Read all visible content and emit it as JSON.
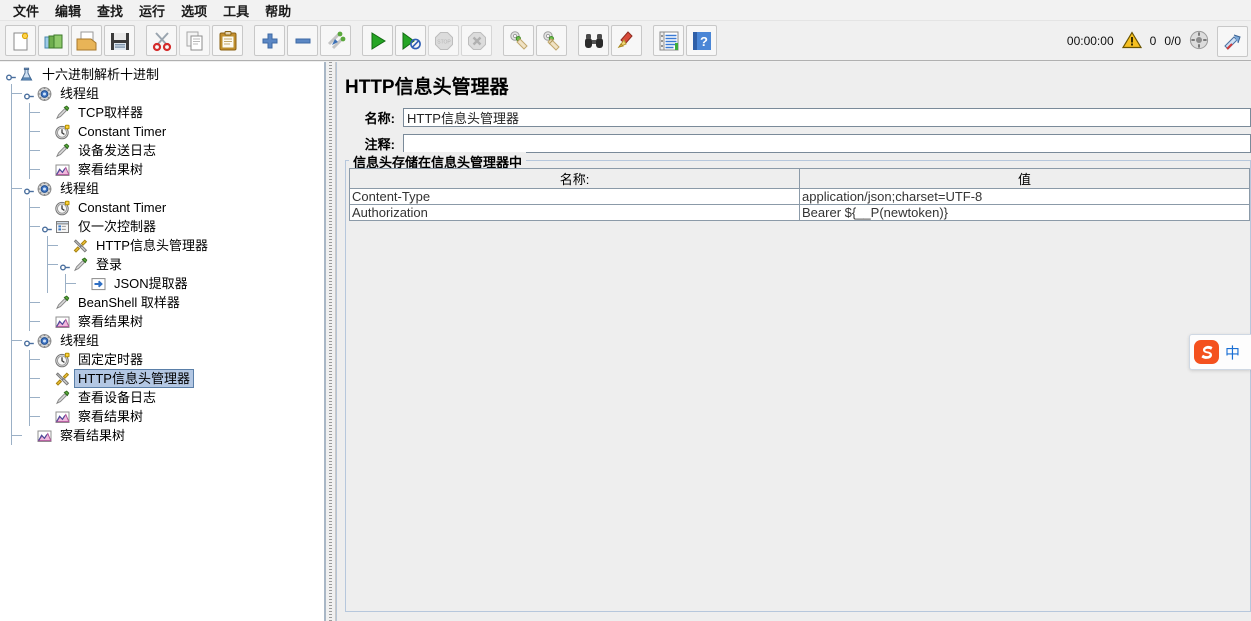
{
  "menubar": {
    "items": [
      {
        "label": "文件",
        "name": "menu-file"
      },
      {
        "label": "编辑",
        "name": "menu-edit"
      },
      {
        "label": "查找",
        "name": "menu-search"
      },
      {
        "label": "运行",
        "name": "menu-run"
      },
      {
        "label": "选项",
        "name": "menu-options"
      },
      {
        "label": "工具",
        "name": "menu-tools"
      },
      {
        "label": "帮助",
        "name": "menu-help"
      }
    ]
  },
  "toolbar": {
    "buttons": [
      {
        "icon": "new-document-icon",
        "title": "新建"
      },
      {
        "icon": "open-templates-icon",
        "title": "模板"
      },
      {
        "icon": "open-folder-icon",
        "title": "打开"
      },
      {
        "icon": "save-floppy-icon",
        "title": "保存"
      },
      {
        "icon": "cut-scissors-icon",
        "title": "剪切"
      },
      {
        "icon": "copy-pages-icon",
        "title": "复制"
      },
      {
        "icon": "paste-clipboard-icon",
        "title": "粘贴"
      },
      {
        "icon": "expand-plus-icon",
        "title": "展开全部"
      },
      {
        "icon": "collapse-minus-icon",
        "title": "折叠全部"
      },
      {
        "icon": "toggle-element-icon",
        "title": "启用/禁用"
      },
      {
        "icon": "start-play-icon",
        "title": "启动"
      },
      {
        "icon": "start-no-pauses-icon",
        "title": "无间隔启动"
      },
      {
        "icon": "stop-icon",
        "title": "停止"
      },
      {
        "icon": "shutdown-icon",
        "title": "关闭"
      },
      {
        "icon": "clear-broom-icon",
        "title": "清除"
      },
      {
        "icon": "clear-all-broom-icon",
        "title": "清除全部"
      },
      {
        "icon": "search-binoculars-icon",
        "title": "查找"
      },
      {
        "icon": "reset-search-broom-icon",
        "title": "重置查找"
      },
      {
        "icon": "function-helper-icon",
        "title": "函数助手对话框"
      },
      {
        "icon": "help-book-icon",
        "title": "帮助"
      }
    ],
    "status": {
      "elapsed": "00:00:00",
      "warning_icon": "warning-triangle-icon",
      "warning_count": "0",
      "threads": "0/0",
      "remote_icon": "remote-status-icon",
      "last_icon": "scissor-tool-icon"
    }
  },
  "tree": {
    "nodes": [
      {
        "label": "十六进制解析十进制",
        "icon": "test-plan-icon",
        "depth": 0,
        "handle": "expanded",
        "selected": false
      },
      {
        "label": "线程组",
        "icon": "thread-group-icon",
        "depth": 1,
        "handle": "expanded",
        "selected": false
      },
      {
        "label": "TCP取样器",
        "icon": "sampler-icon",
        "depth": 2,
        "handle": "leaf",
        "selected": false
      },
      {
        "label": "Constant Timer",
        "icon": "timer-icon",
        "depth": 2,
        "handle": "leaf",
        "selected": false
      },
      {
        "label": "设备发送日志",
        "icon": "sampler-icon",
        "depth": 2,
        "handle": "leaf",
        "selected": false
      },
      {
        "label": "察看结果树",
        "icon": "view-results-tree-icon",
        "depth": 2,
        "handle": "leaf-last",
        "selected": false
      },
      {
        "label": "线程组",
        "icon": "thread-group-icon",
        "depth": 1,
        "handle": "expanded",
        "selected": false
      },
      {
        "label": "Constant Timer",
        "icon": "timer-icon",
        "depth": 2,
        "handle": "leaf",
        "selected": false
      },
      {
        "label": "仅一次控制器",
        "icon": "once-only-controller-icon",
        "depth": 2,
        "handle": "expanded",
        "selected": false
      },
      {
        "label": "HTTP信息头管理器",
        "icon": "header-manager-icon",
        "depth": 3,
        "handle": "leaf",
        "selected": false
      },
      {
        "label": "登录",
        "icon": "sampler-icon",
        "depth": 3,
        "handle": "expanded",
        "selected": false
      },
      {
        "label": "JSON提取器",
        "icon": "json-extractor-icon",
        "depth": 4,
        "handle": "leaf-last",
        "selected": false
      },
      {
        "label": "BeanShell 取样器",
        "icon": "sampler-icon",
        "depth": 2,
        "handle": "leaf",
        "selected": false
      },
      {
        "label": "察看结果树",
        "icon": "view-results-tree-icon",
        "depth": 2,
        "handle": "leaf-last",
        "selected": false
      },
      {
        "label": "线程组",
        "icon": "thread-group-icon",
        "depth": 1,
        "handle": "expanded",
        "selected": false
      },
      {
        "label": "固定定时器",
        "icon": "timer-icon",
        "depth": 2,
        "handle": "leaf",
        "selected": false
      },
      {
        "label": "HTTP信息头管理器",
        "icon": "header-manager-icon",
        "depth": 2,
        "handle": "leaf",
        "selected": true
      },
      {
        "label": "查看设备日志",
        "icon": "sampler-icon",
        "depth": 2,
        "handle": "leaf",
        "selected": false
      },
      {
        "label": "察看结果树",
        "icon": "view-results-tree-icon",
        "depth": 2,
        "handle": "leaf-last",
        "selected": false
      },
      {
        "label": "察看结果树",
        "icon": "view-results-tree-icon",
        "depth": 1,
        "handle": "leaf-last",
        "selected": false
      }
    ]
  },
  "panel": {
    "title": "HTTP信息头管理器",
    "name_label": "名称:",
    "name_value": "HTTP信息头管理器",
    "comment_label": "注释:",
    "comment_value": "",
    "comment_placeholder": "",
    "group_title": "信息头存储在信息头管理器中",
    "table": {
      "columns": [
        "名称:",
        "值"
      ],
      "rows": [
        [
          "Content-Type",
          "application/json;charset=UTF-8"
        ],
        [
          "Authorization",
          "Bearer ${__P(newtoken)}"
        ]
      ]
    }
  },
  "ime": {
    "logo": "sogou-logo-icon",
    "mode": "中"
  },
  "colors": {
    "selection": "#b3c7e3",
    "panel_bg": "#eeeeee",
    "toolbar_bg": "#f0f0f0",
    "accent_blue": "#1a6fd4",
    "sogou_orange": "#f4511e",
    "table_border": "#8b9aa8"
  }
}
